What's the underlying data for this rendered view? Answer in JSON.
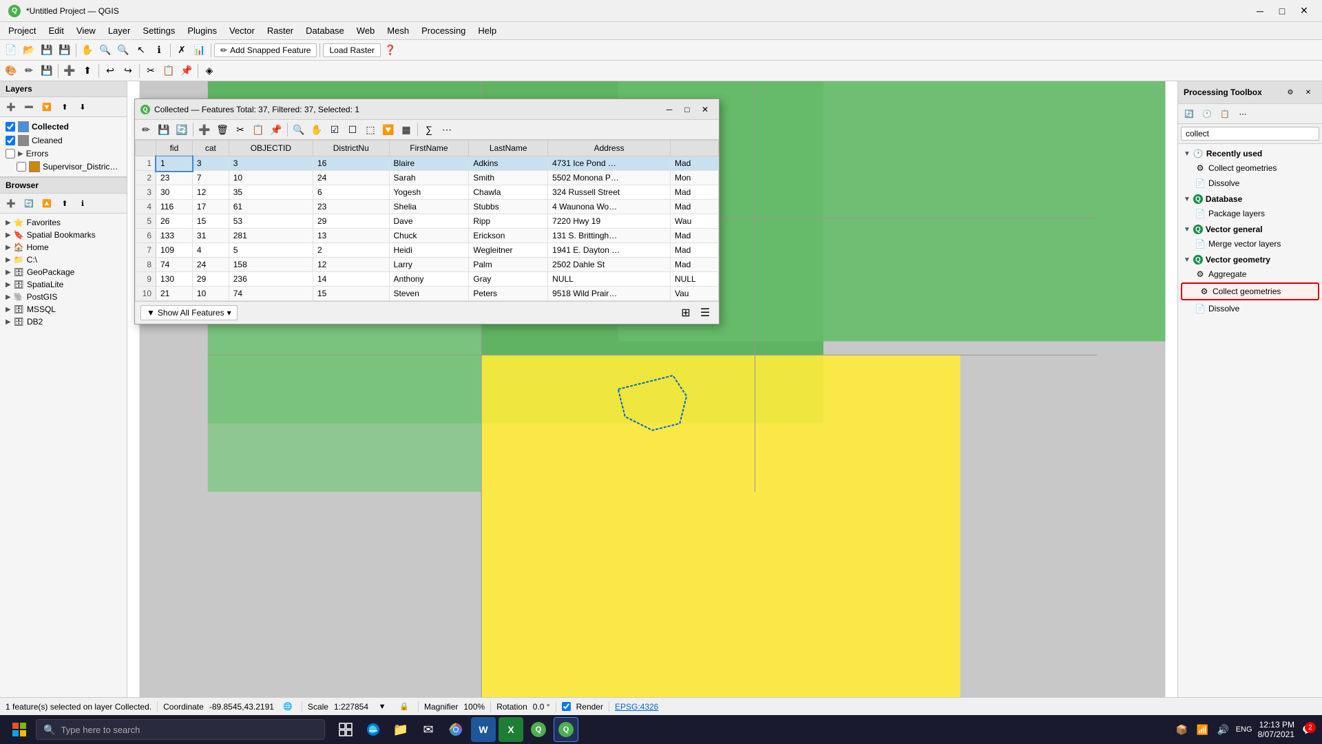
{
  "titlebar": {
    "title": "*Untitled Project — QGIS",
    "icon": "Q"
  },
  "menubar": {
    "items": [
      "Project",
      "Edit",
      "View",
      "Layer",
      "Settings",
      "Plugins",
      "Vector",
      "Raster",
      "Database",
      "Web",
      "Mesh",
      "Processing",
      "Help"
    ]
  },
  "toolbar": {
    "add_snapped_label": "Add Snapped Feature",
    "load_raster_label": "Load Raster"
  },
  "layers_panel": {
    "title": "Layers",
    "items": [
      {
        "name": "Collected",
        "color": "#4a90d9",
        "checked": true,
        "type": "vector"
      },
      {
        "name": "Cleaned",
        "color": "#888888",
        "checked": true,
        "type": "vector"
      },
      {
        "name": "Errors",
        "color": "#cc0000",
        "checked": false,
        "type": "group"
      },
      {
        "name": "Supervisor_Distric…",
        "color": "#cc8800",
        "checked": false,
        "type": "vector"
      }
    ]
  },
  "browser_panel": {
    "title": "Browser",
    "items": [
      {
        "name": "Favorites",
        "icon": "⭐",
        "expandable": true
      },
      {
        "name": "Spatial Bookmarks",
        "icon": "🔖",
        "expandable": true
      },
      {
        "name": "Home",
        "icon": "🏠",
        "expandable": true
      },
      {
        "name": "C:\\",
        "icon": "📁",
        "expandable": true
      },
      {
        "name": "GeoPackage",
        "icon": "🗄",
        "expandable": true
      },
      {
        "name": "SpatiaLite",
        "icon": "🗄",
        "expandable": true
      },
      {
        "name": "PostGIS",
        "icon": "🐘",
        "expandable": true
      },
      {
        "name": "MSSQL",
        "icon": "🗄",
        "expandable": true
      },
      {
        "name": "DB2",
        "icon": "🗄",
        "expandable": true
      }
    ]
  },
  "dialog": {
    "title": "Collected — Features Total: 37, Filtered: 37, Selected: 1",
    "columns": [
      "fid",
      "cat",
      "OBJECTID",
      "DistrictNu",
      "FirstName",
      "LastName",
      "Address"
    ],
    "rows": [
      {
        "num": 1,
        "fid": "1",
        "cat": "3",
        "objectid": "3",
        "district": "16",
        "firstname": "Blaire",
        "lastname": "Adkins",
        "address": "4731 Ice Pond …",
        "extra": "Mad",
        "selected": true
      },
      {
        "num": 2,
        "fid": "23",
        "cat": "7",
        "objectid": "10",
        "district": "24",
        "firstname": "Sarah",
        "lastname": "Smith",
        "address": "5502 Monona P…",
        "extra": "Mon"
      },
      {
        "num": 3,
        "fid": "30",
        "cat": "12",
        "objectid": "35",
        "district": "6",
        "firstname": "Yogesh",
        "lastname": "Chawla",
        "address": "324 Russell Street",
        "extra": "Mad"
      },
      {
        "num": 4,
        "fid": "116",
        "cat": "17",
        "objectid": "61",
        "district": "23",
        "firstname": "Shelia",
        "lastname": "Stubbs",
        "address": "4 Waunona Wo…",
        "extra": "Mad"
      },
      {
        "num": 5,
        "fid": "26",
        "cat": "15",
        "objectid": "53",
        "district": "29",
        "firstname": "Dave",
        "lastname": "Ripp",
        "address": "7220 Hwy 19",
        "extra": "Wau"
      },
      {
        "num": 6,
        "fid": "133",
        "cat": "31",
        "objectid": "281",
        "district": "13",
        "firstname": "Chuck",
        "lastname": "Erickson",
        "address": "131 S. Brittingh…",
        "extra": "Mad"
      },
      {
        "num": 7,
        "fid": "109",
        "cat": "4",
        "objectid": "5",
        "district": "2",
        "firstname": "Heidi",
        "lastname": "Wegleitner",
        "address": "1941 E. Dayton …",
        "extra": "Mad"
      },
      {
        "num": 8,
        "fid": "74",
        "cat": "24",
        "objectid": "158",
        "district": "12",
        "firstname": "Larry",
        "lastname": "Palm",
        "address": "2502 Dahle St",
        "extra": "Mad"
      },
      {
        "num": 9,
        "fid": "130",
        "cat": "29",
        "objectid": "236",
        "district": "14",
        "firstname": "Anthony",
        "lastname": "Gray",
        "address": "NULL",
        "extra": "NULL"
      },
      {
        "num": 10,
        "fid": "21",
        "cat": "10",
        "objectid": "74",
        "district": "15",
        "firstname": "Steven",
        "lastname": "Peters",
        "address": "9518 Wild Prair…",
        "extra": "Vau"
      }
    ],
    "footer_btn": "Show All Features"
  },
  "processing_toolbox": {
    "title": "Processing Toolbox",
    "search_placeholder": "collect",
    "sections": [
      {
        "name": "Recently used",
        "icon": "🕐",
        "expanded": true,
        "items": [
          {
            "name": "Collect geometries",
            "icon": "gear"
          },
          {
            "name": "Dissolve",
            "icon": "doc"
          }
        ]
      },
      {
        "name": "Database",
        "icon": "Q",
        "expanded": true,
        "items": [
          {
            "name": "Package layers",
            "icon": "doc"
          }
        ]
      },
      {
        "name": "Vector general",
        "icon": "Q",
        "expanded": true,
        "items": [
          {
            "name": "Merge vector layers",
            "icon": "doc"
          }
        ]
      },
      {
        "name": "Vector geometry",
        "icon": "Q",
        "expanded": true,
        "items": [
          {
            "name": "Aggregate",
            "icon": "gear"
          },
          {
            "name": "Collect geometries",
            "icon": "gear",
            "highlighted": true
          },
          {
            "name": "Dissolve",
            "icon": "doc"
          }
        ]
      }
    ]
  },
  "statusbar": {
    "message": "1 feature(s) selected on layer Collected.",
    "coordinate_label": "Coordinate",
    "coordinate": "-89.8545,43.2191",
    "scale_label": "Scale",
    "scale": "1:227854",
    "magnifier_label": "Magnifier",
    "magnifier": "100%",
    "rotation_label": "Rotation",
    "rotation": "0.0 °",
    "render_label": "Render",
    "crs": "EPSG:4326"
  },
  "taskbar": {
    "search_placeholder": "Type here to search",
    "time": "12:13 PM",
    "date": "8/07/2021",
    "notification_count": "2",
    "lang": "ENG"
  }
}
